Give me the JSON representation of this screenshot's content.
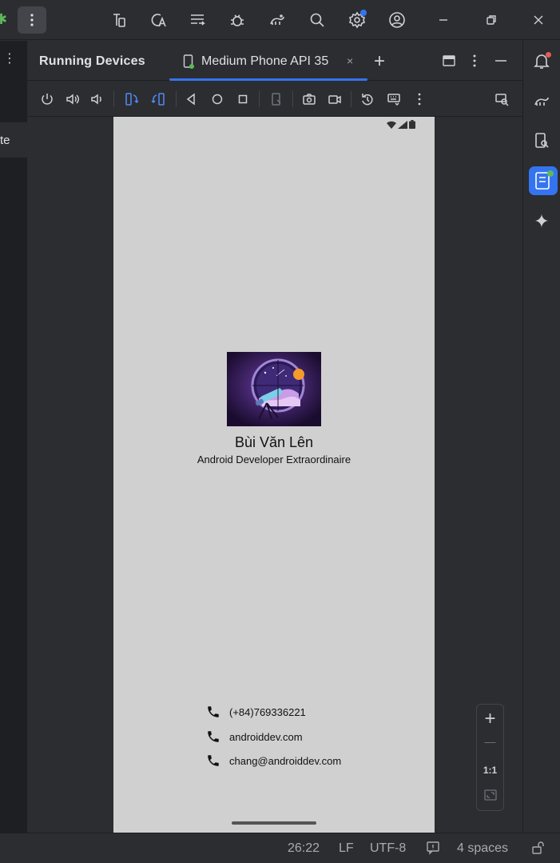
{
  "toolwindow": {
    "title": "Running Devices",
    "tab_label": "Medium Phone API 35",
    "tab_close": "×",
    "add_tab": "+"
  },
  "left_strip": {
    "partial_text": "te"
  },
  "app": {
    "name": "Bùi Văn Lên",
    "role": "Android Developer Extraordinaire",
    "contacts": [
      {
        "icon": "phone-icon",
        "text": "(+84)769336221"
      },
      {
        "icon": "phone-icon",
        "text": "androiddev.com"
      },
      {
        "icon": "phone-icon",
        "text": "chang@androiddev.com"
      }
    ]
  },
  "zoom": {
    "in": "+",
    "out": "—",
    "actual": "1:1"
  },
  "statusbar": {
    "position": "26:22",
    "line_ending": "LF",
    "encoding": "UTF-8",
    "indent": "4 spaces"
  },
  "colors": {
    "accent": "#3574f0",
    "ide_bg": "#2b2d30",
    "phone_bg": "#d0d0d0",
    "notification_dot": "#e55b5b",
    "device_online": "#5fb85a"
  }
}
